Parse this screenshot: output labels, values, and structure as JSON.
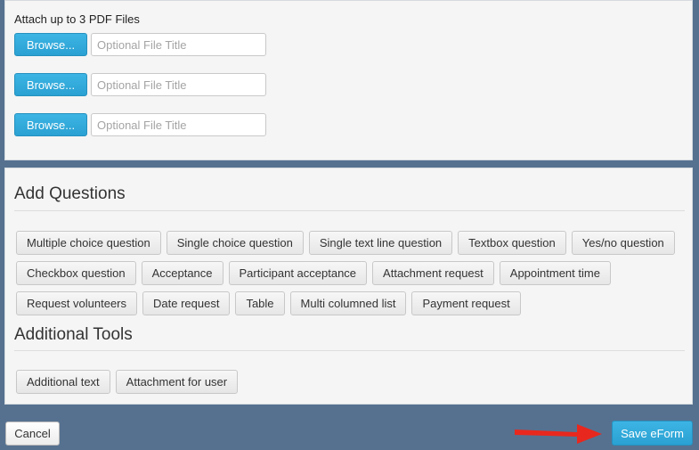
{
  "attachments": {
    "title": "Attach up to 3 PDF Files",
    "rows": [
      {
        "browse_label": "Browse...",
        "placeholder": "Optional File Title"
      },
      {
        "browse_label": "Browse...",
        "placeholder": "Optional File Title"
      },
      {
        "browse_label": "Browse...",
        "placeholder": "Optional File Title"
      }
    ]
  },
  "questions": {
    "heading": "Add Questions",
    "row1": [
      "Multiple choice question",
      "Single choice question",
      "Single text line question",
      "Textbox question",
      "Yes/no question"
    ],
    "row2": [
      "Checkbox question",
      "Acceptance",
      "Participant acceptance",
      "Attachment request",
      "Appointment time"
    ],
    "row3": [
      "Request volunteers",
      "Date request",
      "Table",
      "Multi columned list",
      "Payment request"
    ]
  },
  "tools": {
    "heading": "Additional Tools",
    "items": [
      "Additional text",
      "Attachment for user"
    ]
  },
  "footer": {
    "cancel_label": "Cancel",
    "save_label": "Save eForm",
    "arrow_color": "#e8281e"
  },
  "colors": {
    "background": "#567190",
    "accent": "#2aa1d2"
  }
}
